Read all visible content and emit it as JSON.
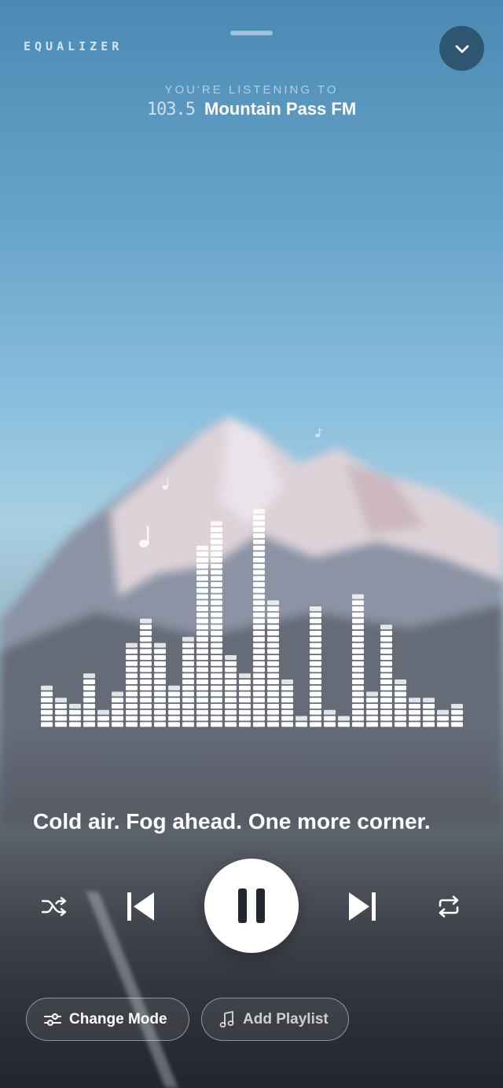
{
  "header": {
    "section_label": "EQUALIZER",
    "listening_label": "YOU'RE LISTENING TO",
    "frequency": "103.5",
    "station_name": "Mountain Pass FM"
  },
  "visualizer": {
    "levels": [
      7,
      5,
      4,
      9,
      3,
      6,
      14,
      18,
      14,
      7,
      15,
      30,
      34,
      12,
      9,
      36,
      21,
      8,
      2,
      20,
      3,
      2,
      22,
      6,
      17,
      8,
      5,
      5,
      3,
      4
    ]
  },
  "now_playing": {
    "lyric": "Cold air. Fog ahead. One more corner."
  },
  "controls": {
    "shuffle_icon": "shuffle-icon",
    "previous_icon": "skip-previous-icon",
    "play_state": "playing",
    "next_icon": "skip-next-icon",
    "repeat_icon": "repeat-icon"
  },
  "actions": {
    "change_mode_label": "Change Mode",
    "add_playlist_label": "Add Playlist"
  }
}
